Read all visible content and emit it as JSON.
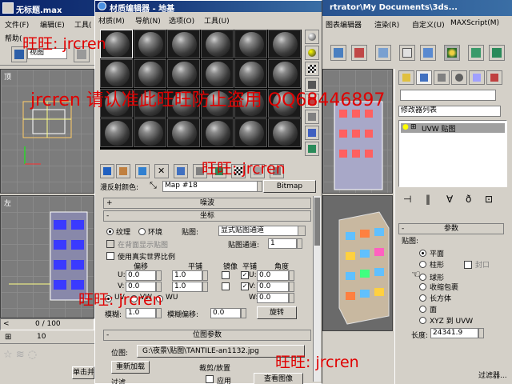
{
  "max": {
    "title": "无标题.max",
    "title_right": "rtrator\\My Documents\\3ds...",
    "menu": [
      "文件(F)",
      "编辑(E)",
      "工具(",
      "帮助("
    ],
    "menu_right": [
      "图表编辑器",
      "渲染(R)",
      "自定义(U)",
      "MAXScript(M)"
    ],
    "view_dropdown": "视图",
    "viewport_top_label": "顶",
    "viewport_left_label": "左",
    "time_counter": "0 / 100",
    "status_button": "单击并",
    "status_filter": "过滤器..."
  },
  "cmd_panel": {
    "modifier_list": "修改器列表",
    "stack_item": "UVW 贴图",
    "params_header": "参数",
    "mapping_group": "贴图:",
    "mapping_options": [
      "平面",
      "柱形",
      "球形",
      "收缩包裹",
      "长方体",
      "面",
      "XYZ 到 UVW"
    ],
    "cap_label": "封口",
    "selected_mapping": "平面",
    "length_label": "长度:",
    "length_value": "24341.9"
  },
  "mat_editor": {
    "title": "材质编辑器 - 地基",
    "menu": [
      "材质(M)",
      "导航(N)",
      "选项(O)",
      "工具(U)"
    ],
    "diffuse_label": "漫反射颜色:",
    "map_name": "Map #18",
    "map_type": "Bitmap",
    "rollouts": {
      "noise": "噪波",
      "coordinates": "坐标",
      "bitmap_params": "位图参数"
    },
    "texture_radio": "纹理",
    "environ_radio": "环境",
    "map_label": "贴图:",
    "map_mode": "显式贴图通道",
    "show_map_on_back": "在背面显示贴图",
    "map_channel_label": "贴图通道:",
    "map_channel": "1",
    "real_world_scale": "使用真实世界比例",
    "col_offset": "偏移",
    "col_tiling": "平铺",
    "col_mirror": "镜像",
    "col_tile": "平铺",
    "col_angle": "角度",
    "u_label": "U:",
    "v_label": "V:",
    "w_label": "W:",
    "u_offset": "0.0",
    "v_offset": "0.0",
    "u_tiling": "1.0",
    "v_tiling": "1.0",
    "u_angle": "0.0",
    "v_angle": "0.0",
    "w_angle": "0.0",
    "uv_label": "UV",
    "vw_label": "VW",
    "wu_label": "WU",
    "blur_label": "模糊:",
    "blur_value": "1.0",
    "blur_offset_label": "模糊偏移:",
    "blur_offset_value": "0.0",
    "rotate_button": "旋转",
    "bitmap_label": "位图:",
    "bitmap_path": "G:\\夜景\\贴图\\TANTILE-an1132.jpg",
    "reload_button": "重新加载",
    "crop_group": "裁剪/放置",
    "apply_label": "应用",
    "view_image_button": "查看图像",
    "filter_label": "过滤"
  },
  "watermarks": [
    "旺旺: jrcren",
    "jrcren 请认准此旺旺防止盗用 QQ68446897",
    "旺旺: jrcren",
    "旺旺: jrcren",
    "旺旺: jrcren"
  ],
  "colors": {
    "titlebar": "#0a246a",
    "panel": "#d4d0c8",
    "viewport": "#7c7c7c",
    "watermark": "#e00000"
  }
}
